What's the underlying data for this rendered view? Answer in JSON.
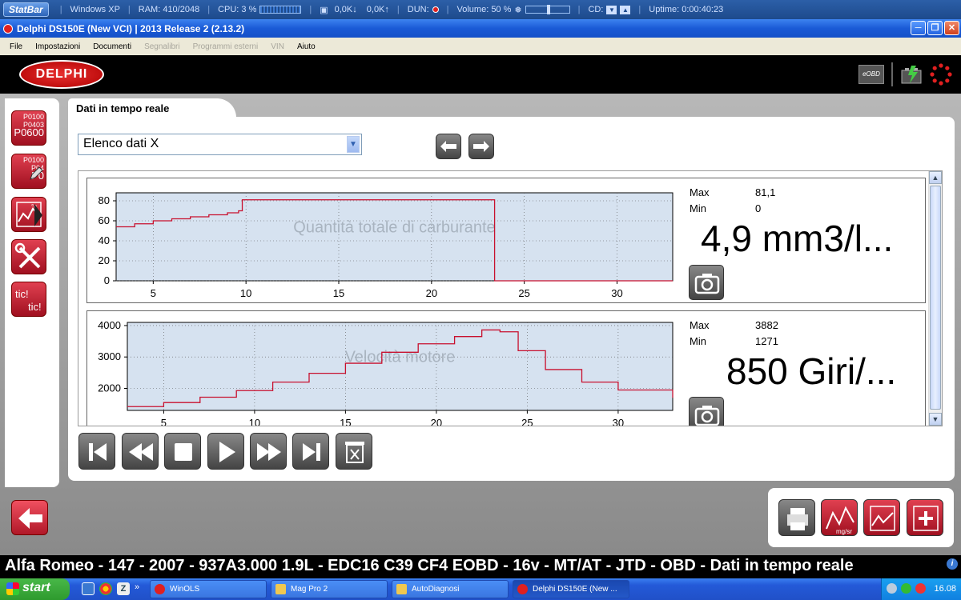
{
  "statbar": {
    "logo": "StatBar",
    "os": "Windows XP",
    "ram": "RAM: 410/2048",
    "cpu": "CPU: 3 %",
    "net_down": "0,0K↓",
    "net_up": "0,0K↑",
    "dun": "DUN:",
    "volume": "Volume: 50 %",
    "cd": "CD:",
    "uptime": "Uptime: 0:00:40:23"
  },
  "window": {
    "title": "Delphi DS150E (New VCI)  |  2013 Release 2 (2.13.2)"
  },
  "menu": {
    "file": "File",
    "impostazioni": "Impostazioni",
    "documenti": "Documenti",
    "segnalibri": "Segnalibri",
    "programmi": "Programmi esterni",
    "vin": "VIN",
    "aiuto": "Aiuto"
  },
  "header": {
    "logo": "DELPHI",
    "eobd": "eOBD"
  },
  "sidebar": {
    "dtc1": [
      "P0100",
      "P0403",
      "P0600"
    ],
    "dtc2": [
      "P0100",
      "P04",
      "P0"
    ],
    "tic": [
      "tic!",
      "tic!"
    ]
  },
  "tab": {
    "title": "Dati in tempo reale"
  },
  "dropdown": {
    "value": "Elenco dati X"
  },
  "graphs": [
    {
      "name": "Quantità totale di carburante",
      "max_label": "Max",
      "max": "81,1",
      "min_label": "Min",
      "min": "0",
      "value": "4,9 mm3/l..."
    },
    {
      "name": "Velocità motore",
      "max_label": "Max",
      "max": "3882",
      "min_label": "Min",
      "min": "1271",
      "value": "850 Giri/..."
    }
  ],
  "chart_data": [
    {
      "type": "line",
      "title": "Quantità totale di carburante",
      "xlabel": "",
      "ylabel": "",
      "xlim": [
        3,
        33
      ],
      "ylim": [
        0,
        88
      ],
      "x_ticks": [
        5,
        10,
        15,
        20,
        25,
        30
      ],
      "y_ticks": [
        0,
        20,
        40,
        60,
        80
      ],
      "grid": true,
      "line_color": "#c8102e",
      "series": [
        {
          "x": [
            3,
            4,
            5,
            6,
            7,
            8,
            9,
            9.6,
            9.8,
            12,
            15,
            18,
            20,
            22,
            23.3,
            23.4,
            24,
            28,
            33
          ],
          "y": [
            54,
            57,
            60,
            62,
            64,
            66,
            68,
            70,
            81,
            81,
            81,
            81,
            81,
            81,
            81,
            0,
            0,
            0,
            0
          ]
        }
      ]
    },
    {
      "type": "line",
      "title": "Velocità motore",
      "xlabel": "",
      "ylabel": "",
      "xlim": [
        3,
        33
      ],
      "ylim": [
        1300,
        4100
      ],
      "x_ticks": [
        5,
        10,
        15,
        20,
        25,
        30
      ],
      "y_ticks": [
        2000,
        3000,
        4000
      ],
      "grid": true,
      "line_color": "#c8102e",
      "series": [
        {
          "x": [
            3,
            5,
            7,
            9,
            11,
            13,
            15,
            17,
            19,
            21,
            22.5,
            23.5,
            24.5,
            26,
            28,
            30,
            33
          ],
          "y": [
            1420,
            1550,
            1720,
            1930,
            2200,
            2480,
            2800,
            3150,
            3420,
            3650,
            3860,
            3800,
            3200,
            2600,
            2200,
            1950,
            1700
          ]
        }
      ]
    }
  ],
  "status": {
    "vehicle": "Alfa Romeo - 147 - 2007 - 937A3.000 1.9L - EDC16 C39 CF4 EOBD - 16v - MT/AT - JTD - OBD - Dati in tempo reale"
  },
  "taskbar": {
    "start": "start",
    "items": [
      "WinOLS",
      "Mag Pro 2",
      "AutoDiagnosi",
      "Delphi DS150E (New ..."
    ],
    "clock": "16.08"
  },
  "colors": {
    "accent_red": "#c8102e",
    "plot_bg": "#d6e2f0"
  }
}
